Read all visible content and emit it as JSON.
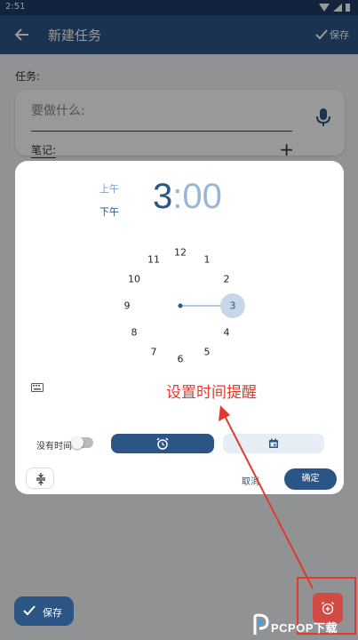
{
  "status_bar": {
    "time": "2:51"
  },
  "app_bar": {
    "title": "新建任务",
    "save_label": "保存"
  },
  "form": {
    "task_label": "任务:",
    "task_placeholder": "要做什么:",
    "notes_label": "笔记:",
    "add_symbol": "+"
  },
  "time_picker": {
    "am_label": "上午",
    "pm_label": "下午",
    "selected_period": "下午",
    "hour": "3",
    "separator": ":",
    "minute": "00",
    "dial_numbers": [
      "12",
      "1",
      "2",
      "3",
      "4",
      "5",
      "6",
      "7",
      "8",
      "9",
      "10",
      "11"
    ],
    "selected_hour": "3",
    "no_time_label": "没有时间",
    "no_time_enabled": false,
    "selected_tab": "alarm",
    "cancel_label": "取消",
    "ok_label": "确定"
  },
  "annotation": {
    "text": "设置时间提醒",
    "color": "#e03a2f"
  },
  "bottom": {
    "save_label": "保存"
  },
  "watermark": {
    "text": "PCPOP下载"
  },
  "colors": {
    "primary": "#2a5585",
    "status_bar": "#1f3d66",
    "fab_reminder": "#d14a44",
    "annotation": "#e03a2f"
  },
  "icons": [
    "back-arrow-icon",
    "check-icon",
    "mic-icon",
    "keyboard-icon",
    "alarm-icon",
    "calendar-icon",
    "compress-icon",
    "alarm-add-icon"
  ]
}
